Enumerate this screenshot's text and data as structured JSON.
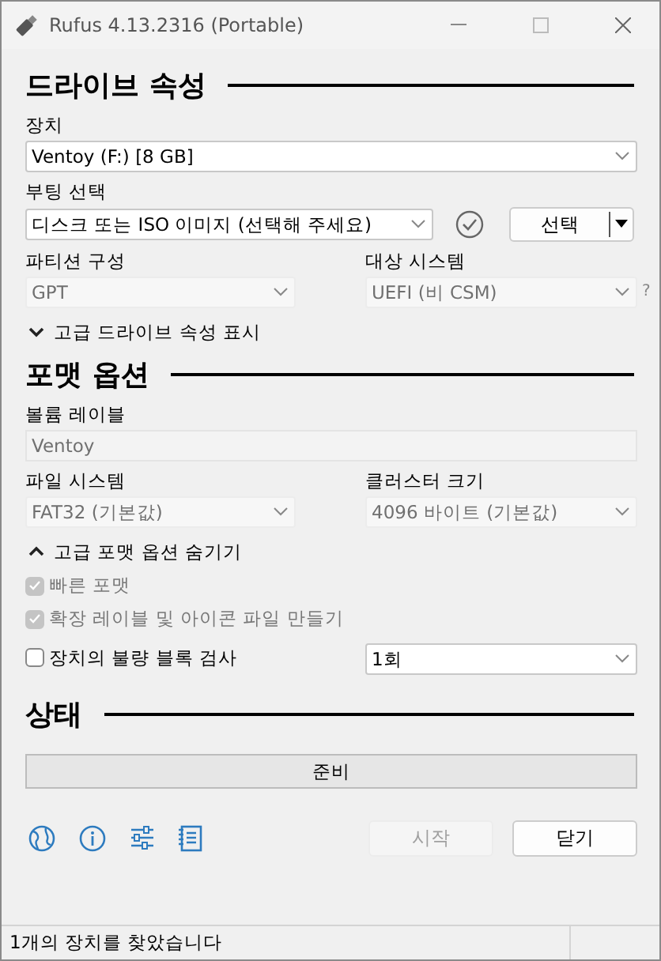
{
  "window": {
    "title": "Rufus 4.13.2316 (Portable)"
  },
  "drive_properties": {
    "heading": "드라이브 속성",
    "device": {
      "label": "장치",
      "value": "Ventoy (F:) [8 GB]",
      "disabled": false
    },
    "boot_selection": {
      "label": "부팅 선택",
      "value": "디스크 또는 ISO 이미지 (선택해 주세요)",
      "disabled": false
    },
    "select_button": {
      "label": "선택"
    },
    "partition_scheme": {
      "label": "파티션 구성",
      "value": "GPT",
      "disabled": true
    },
    "target_system": {
      "label": "대상 시스템",
      "value": "UEFI (비 CSM)",
      "disabled": true
    },
    "help": "?",
    "advanced_toggle": {
      "label": "고급 드라이브 속성 표시",
      "expanded": false
    }
  },
  "format_options": {
    "heading": "포맷 옵션",
    "volume_label": {
      "label": "볼륨 레이블",
      "value": "Ventoy",
      "disabled": true
    },
    "file_system": {
      "label": "파일 시스템",
      "value": "FAT32 (기본값)",
      "disabled": true
    },
    "cluster_size": {
      "label": "클러스터 크기",
      "value": "4096 바이트 (기본값)",
      "disabled": true
    },
    "advanced_toggle": {
      "label": "고급 포맷 옵션 숨기기",
      "expanded": true
    },
    "checks": [
      {
        "label": "빠른 포맷",
        "checked": true,
        "disabled": true
      },
      {
        "label": "확장 레이블 및 아이콘 파일 만들기",
        "checked": true,
        "disabled": true
      },
      {
        "label": "장치의 불량 블록 검사",
        "checked": false,
        "disabled": false
      }
    ],
    "passes": {
      "value": "1회",
      "disabled": false
    }
  },
  "status": {
    "heading": "상태",
    "text": "준비"
  },
  "buttons": {
    "start": {
      "label": "시작",
      "disabled": true
    },
    "close": {
      "label": "닫기",
      "disabled": false
    }
  },
  "status_bar": {
    "text": "1개의 장치를 찾았습니다"
  }
}
